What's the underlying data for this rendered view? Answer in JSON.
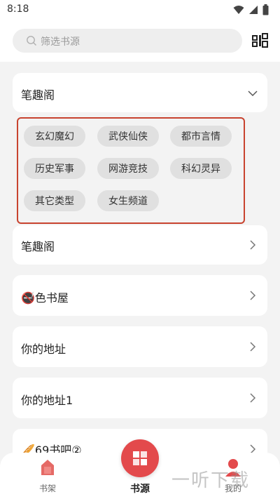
{
  "status_bar": {
    "time": "8:18"
  },
  "search": {
    "placeholder": "筛选书源"
  },
  "sources": [
    {
      "title": "笔趣阁"
    },
    {
      "title": "笔趣阁"
    },
    {
      "title": "🚭色书屋"
    },
    {
      "title": "你的地址"
    },
    {
      "title": "你的地址1"
    },
    {
      "title": "🥖69书吧②"
    }
  ],
  "categories": [
    "玄幻魔幻",
    "武侠仙侠",
    "都市言情",
    "历史军事",
    "网游竞技",
    "科幻灵异",
    "其它类型",
    "女生频道"
  ],
  "bottom_nav": {
    "bookshelf": "书架",
    "sources": "书源",
    "mine": "我的"
  },
  "watermark": "一听下载",
  "colors": {
    "accent": "#e34a4c",
    "highlight_border": "#c8432f"
  }
}
